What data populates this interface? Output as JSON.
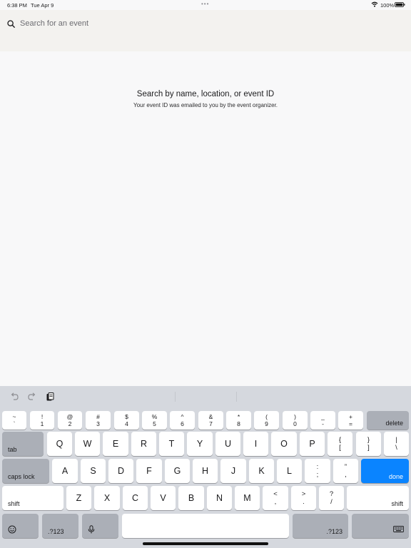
{
  "status_bar": {
    "time": "6:38 PM",
    "date": "Tue Apr 9",
    "battery": "100%",
    "icons": [
      "wifi-icon",
      "battery-icon"
    ]
  },
  "search": {
    "placeholder": "Search for an event",
    "value": ""
  },
  "empty_state": {
    "title": "Search by name, location, or event ID",
    "subtitle": "Your event ID was emailed to you by the event organizer."
  },
  "keyboard": {
    "toolbar_icons": [
      "undo-icon",
      "redo-icon",
      "paste-icon"
    ],
    "number_row": [
      {
        "top": "~",
        "bottom": "`"
      },
      {
        "top": "!",
        "bottom": "1"
      },
      {
        "top": "@",
        "bottom": "2"
      },
      {
        "top": "#",
        "bottom": "3"
      },
      {
        "top": "$",
        "bottom": "4"
      },
      {
        "top": "%",
        "bottom": "5"
      },
      {
        "top": "^",
        "bottom": "6"
      },
      {
        "top": "&",
        "bottom": "7"
      },
      {
        "top": "*",
        "bottom": "8"
      },
      {
        "top": "(",
        "bottom": "9"
      },
      {
        "top": ")",
        "bottom": "0"
      },
      {
        "top": "_",
        "bottom": "-"
      },
      {
        "top": "+",
        "bottom": "="
      }
    ],
    "delete_label": "delete",
    "tab_label": "tab",
    "row_q": [
      "Q",
      "W",
      "E",
      "R",
      "T",
      "Y",
      "U",
      "I",
      "O",
      "P"
    ],
    "row_q_symbols": [
      {
        "top": "{",
        "bottom": "["
      },
      {
        "top": "}",
        "bottom": "]"
      },
      {
        "top": "|",
        "bottom": "\\"
      }
    ],
    "caps_label": "caps lock",
    "row_a": [
      "A",
      "S",
      "D",
      "F",
      "G",
      "H",
      "J",
      "K",
      "L"
    ],
    "row_a_symbols": [
      {
        "top": ":",
        "bottom": ";"
      },
      {
        "top": "”",
        "bottom": ","
      }
    ],
    "done_label": "done",
    "shift_label": "shift",
    "row_z": [
      "Z",
      "X",
      "C",
      "V",
      "B",
      "N",
      "M"
    ],
    "row_z_symbols": [
      {
        "top": "<",
        "bottom": ","
      },
      {
        "top": ">",
        "bottom": "."
      },
      {
        "top": "?",
        "bottom": "/"
      }
    ],
    "numbers_label": ".?123",
    "accent_color": "#0a84ff"
  }
}
